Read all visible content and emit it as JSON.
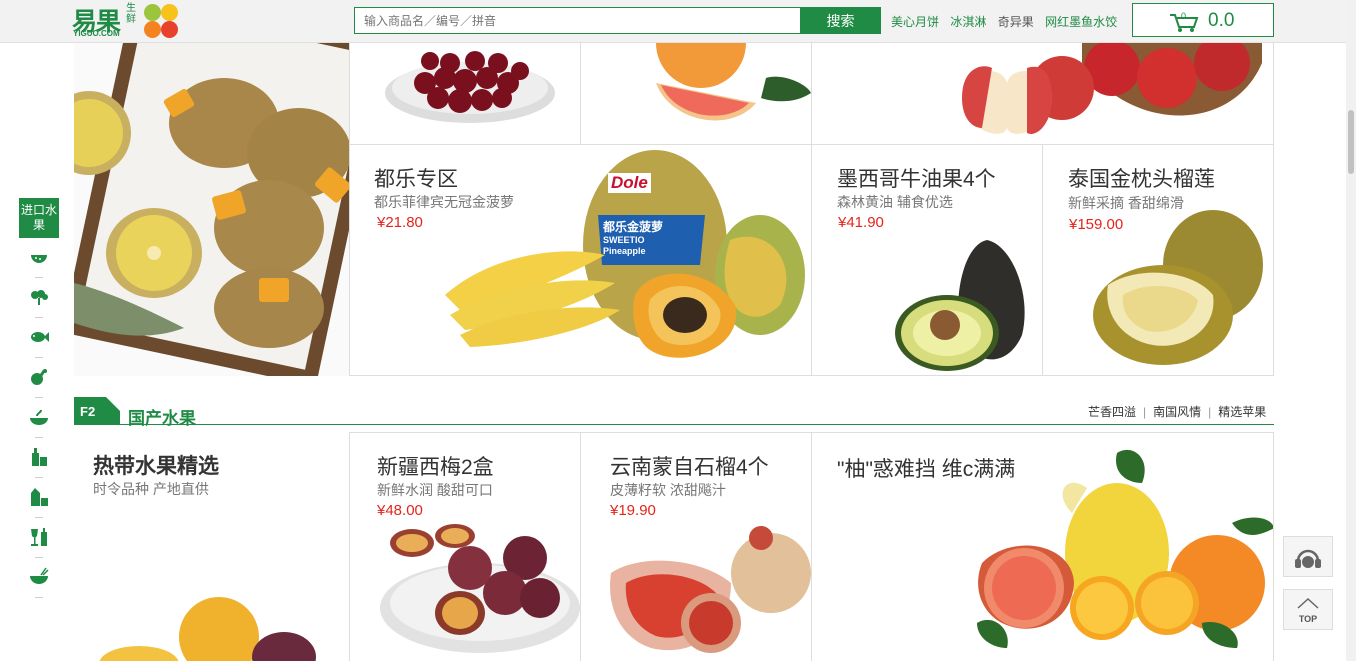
{
  "header": {
    "logo_text": "易果",
    "logo_sub": "生鲜",
    "logo_en": "YIGUO.COM",
    "search_placeholder": "输入商品名／编号／拼音",
    "search_button": "搜索",
    "hot_links": [
      "美心月饼",
      "冰淇淋",
      "奇异果",
      "网红墨鱼水饺"
    ],
    "cart_count": "0",
    "cart_total": "0.0"
  },
  "side_nav": {
    "active_label": "进口水果",
    "items": [
      "watermelon-icon",
      "vegetable-icon",
      "fish-icon",
      "meat-icon",
      "bowl-icon",
      "bottle-icon",
      "milk-icon",
      "wine-icon",
      "noodle-icon"
    ]
  },
  "f1": {
    "dole": {
      "title": "都乐专区",
      "sub": "都乐菲律宾无冠金菠萝",
      "price": "¥21.80"
    },
    "avocado": {
      "title": "墨西哥牛油果4个",
      "sub": "森林黄油 辅食优选",
      "price": "¥41.90"
    },
    "durian": {
      "title": "泰国金枕头榴莲",
      "sub": "新鲜采摘 香甜绵滑",
      "price": "¥159.00"
    },
    "dole_label": "Dole",
    "dole_pack": "都乐金菠萝",
    "dole_pack_en": "SWEETIO Pineapple"
  },
  "f2": {
    "tag": "F2",
    "title": "国产水果",
    "links": [
      "芒香四溢",
      "南国风情",
      "精选苹果"
    ],
    "tropical": {
      "title": "热带水果精选",
      "sub": "时令品种 产地直供"
    },
    "plum": {
      "title": "新疆西梅2盒",
      "sub": "新鲜水润 酸甜可口",
      "price": "¥48.00"
    },
    "pomegranate": {
      "title": "云南蒙自石榴4个",
      "sub": "皮薄籽软 浓甜飚汁",
      "price": "¥19.90"
    },
    "pomelo": {
      "title": "\"柚\"惑难挡 维c满满"
    }
  },
  "tools": {
    "top_label": "TOP"
  },
  "colors": {
    "brand": "#1f8b45",
    "price": "#e3241b"
  }
}
